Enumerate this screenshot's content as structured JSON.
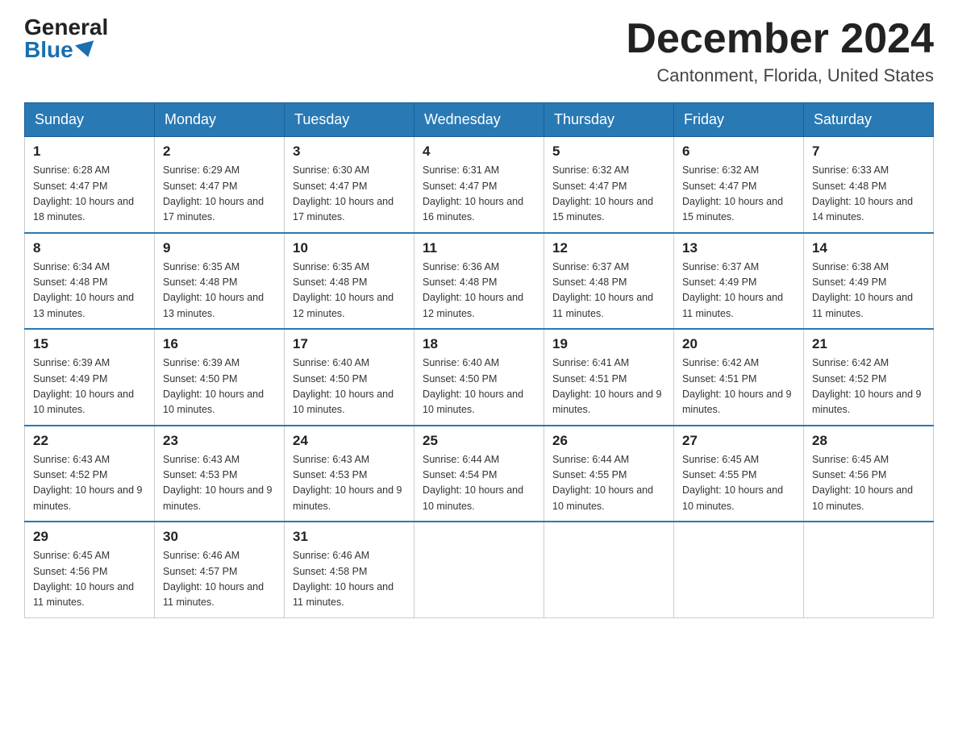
{
  "header": {
    "logo_general": "General",
    "logo_blue": "Blue",
    "month_title": "December 2024",
    "location": "Cantonment, Florida, United States"
  },
  "days_of_week": [
    "Sunday",
    "Monday",
    "Tuesday",
    "Wednesday",
    "Thursday",
    "Friday",
    "Saturday"
  ],
  "weeks": [
    [
      {
        "day": "1",
        "sunrise": "6:28 AM",
        "sunset": "4:47 PM",
        "daylight": "10 hours and 18 minutes."
      },
      {
        "day": "2",
        "sunrise": "6:29 AM",
        "sunset": "4:47 PM",
        "daylight": "10 hours and 17 minutes."
      },
      {
        "day": "3",
        "sunrise": "6:30 AM",
        "sunset": "4:47 PM",
        "daylight": "10 hours and 17 minutes."
      },
      {
        "day": "4",
        "sunrise": "6:31 AM",
        "sunset": "4:47 PM",
        "daylight": "10 hours and 16 minutes."
      },
      {
        "day": "5",
        "sunrise": "6:32 AM",
        "sunset": "4:47 PM",
        "daylight": "10 hours and 15 minutes."
      },
      {
        "day": "6",
        "sunrise": "6:32 AM",
        "sunset": "4:47 PM",
        "daylight": "10 hours and 15 minutes."
      },
      {
        "day": "7",
        "sunrise": "6:33 AM",
        "sunset": "4:48 PM",
        "daylight": "10 hours and 14 minutes."
      }
    ],
    [
      {
        "day": "8",
        "sunrise": "6:34 AM",
        "sunset": "4:48 PM",
        "daylight": "10 hours and 13 minutes."
      },
      {
        "day": "9",
        "sunrise": "6:35 AM",
        "sunset": "4:48 PM",
        "daylight": "10 hours and 13 minutes."
      },
      {
        "day": "10",
        "sunrise": "6:35 AM",
        "sunset": "4:48 PM",
        "daylight": "10 hours and 12 minutes."
      },
      {
        "day": "11",
        "sunrise": "6:36 AM",
        "sunset": "4:48 PM",
        "daylight": "10 hours and 12 minutes."
      },
      {
        "day": "12",
        "sunrise": "6:37 AM",
        "sunset": "4:48 PM",
        "daylight": "10 hours and 11 minutes."
      },
      {
        "day": "13",
        "sunrise": "6:37 AM",
        "sunset": "4:49 PM",
        "daylight": "10 hours and 11 minutes."
      },
      {
        "day": "14",
        "sunrise": "6:38 AM",
        "sunset": "4:49 PM",
        "daylight": "10 hours and 11 minutes."
      }
    ],
    [
      {
        "day": "15",
        "sunrise": "6:39 AM",
        "sunset": "4:49 PM",
        "daylight": "10 hours and 10 minutes."
      },
      {
        "day": "16",
        "sunrise": "6:39 AM",
        "sunset": "4:50 PM",
        "daylight": "10 hours and 10 minutes."
      },
      {
        "day": "17",
        "sunrise": "6:40 AM",
        "sunset": "4:50 PM",
        "daylight": "10 hours and 10 minutes."
      },
      {
        "day": "18",
        "sunrise": "6:40 AM",
        "sunset": "4:50 PM",
        "daylight": "10 hours and 10 minutes."
      },
      {
        "day": "19",
        "sunrise": "6:41 AM",
        "sunset": "4:51 PM",
        "daylight": "10 hours and 9 minutes."
      },
      {
        "day": "20",
        "sunrise": "6:42 AM",
        "sunset": "4:51 PM",
        "daylight": "10 hours and 9 minutes."
      },
      {
        "day": "21",
        "sunrise": "6:42 AM",
        "sunset": "4:52 PM",
        "daylight": "10 hours and 9 minutes."
      }
    ],
    [
      {
        "day": "22",
        "sunrise": "6:43 AM",
        "sunset": "4:52 PM",
        "daylight": "10 hours and 9 minutes."
      },
      {
        "day": "23",
        "sunrise": "6:43 AM",
        "sunset": "4:53 PM",
        "daylight": "10 hours and 9 minutes."
      },
      {
        "day": "24",
        "sunrise": "6:43 AM",
        "sunset": "4:53 PM",
        "daylight": "10 hours and 9 minutes."
      },
      {
        "day": "25",
        "sunrise": "6:44 AM",
        "sunset": "4:54 PM",
        "daylight": "10 hours and 10 minutes."
      },
      {
        "day": "26",
        "sunrise": "6:44 AM",
        "sunset": "4:55 PM",
        "daylight": "10 hours and 10 minutes."
      },
      {
        "day": "27",
        "sunrise": "6:45 AM",
        "sunset": "4:55 PM",
        "daylight": "10 hours and 10 minutes."
      },
      {
        "day": "28",
        "sunrise": "6:45 AM",
        "sunset": "4:56 PM",
        "daylight": "10 hours and 10 minutes."
      }
    ],
    [
      {
        "day": "29",
        "sunrise": "6:45 AM",
        "sunset": "4:56 PM",
        "daylight": "10 hours and 11 minutes."
      },
      {
        "day": "30",
        "sunrise": "6:46 AM",
        "sunset": "4:57 PM",
        "daylight": "10 hours and 11 minutes."
      },
      {
        "day": "31",
        "sunrise": "6:46 AM",
        "sunset": "4:58 PM",
        "daylight": "10 hours and 11 minutes."
      },
      null,
      null,
      null,
      null
    ]
  ]
}
